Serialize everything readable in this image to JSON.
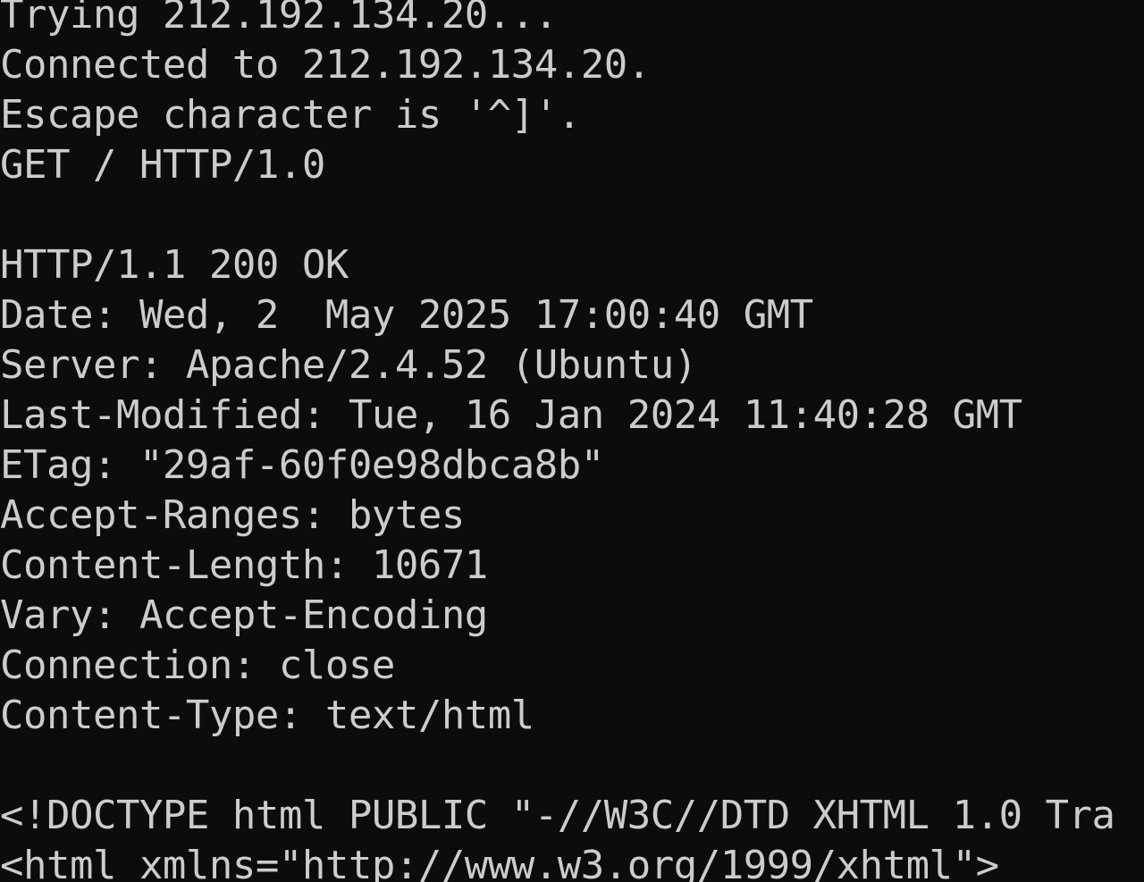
{
  "terminal": {
    "lines": [
      "Trying 212.192.134.20...",
      "Connected to 212.192.134.20.",
      "Escape character is '^]'.",
      "GET / HTTP/1.0",
      "",
      "HTTP/1.1 200 OK",
      "Date: Wed, 2  May 2025 17:00:40 GMT",
      "Server: Apache/2.4.52 (Ubuntu)",
      "Last-Modified: Tue, 16 Jan 2024 11:40:28 GMT",
      "ETag: \"29af-60f0e98dbca8b\"",
      "Accept-Ranges: bytes",
      "Content-Length: 10671",
      "Vary: Accept-Encoding",
      "Connection: close",
      "Content-Type: text/html",
      "",
      "<!DOCTYPE html PUBLIC \"-//W3C//DTD XHTML 1.0 Tra",
      "<html xmlns=\"http://www.w3.org/1999/xhtml\">"
    ],
    "colors": {
      "background": "#0c0c0c",
      "foreground": "#cccccc"
    }
  }
}
